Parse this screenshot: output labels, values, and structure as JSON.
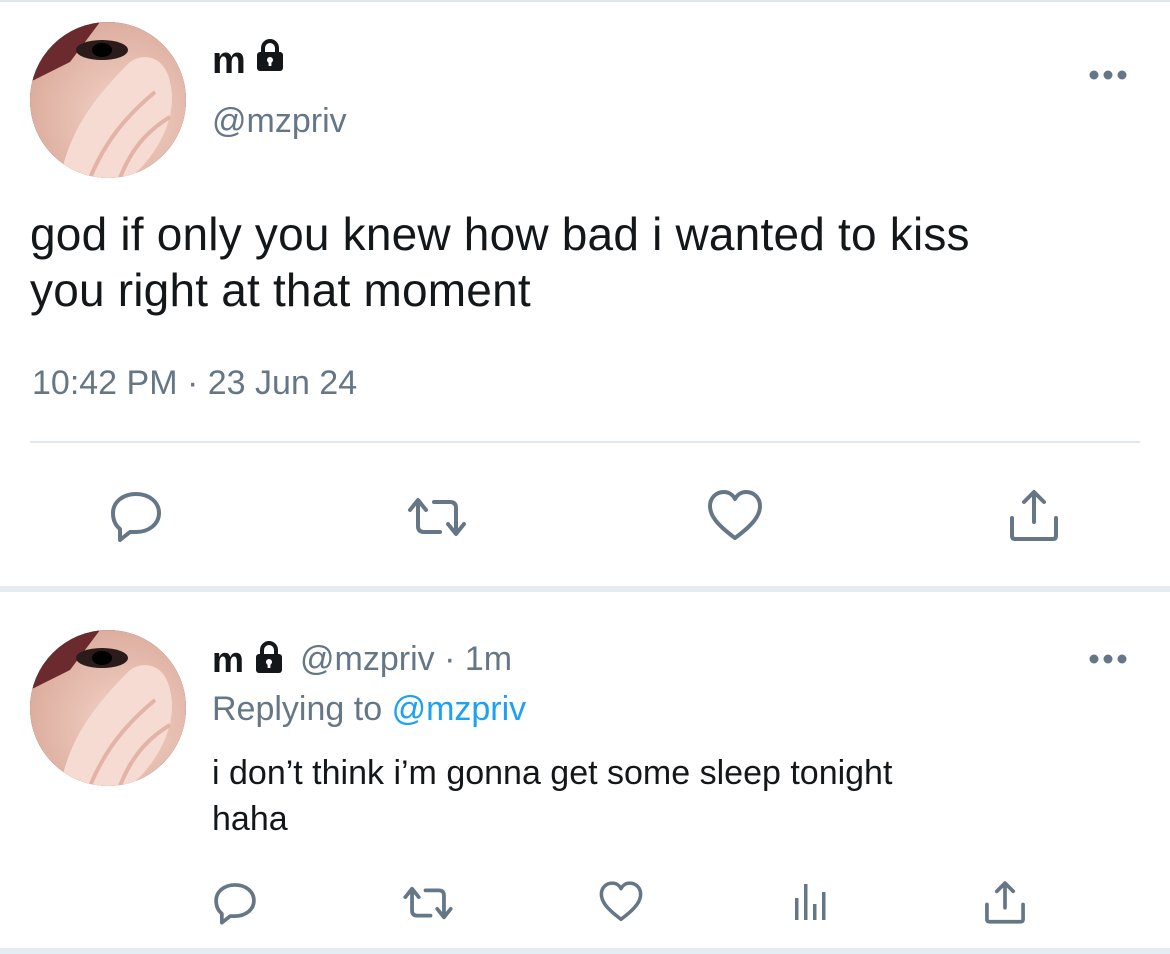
{
  "main_tweet": {
    "display_name": "m",
    "handle": "@mzpriv",
    "text_line1": "god if only you knew how bad i wanted to kiss",
    "text_line2": "you right at that moment",
    "time": "10:42 PM",
    "separator": "·",
    "date": "23 Jun 24"
  },
  "reply_tweet": {
    "display_name": "m",
    "handle": "@mzpriv",
    "separator": "·",
    "age": "1m",
    "replying_prefix": "Replying to",
    "replying_handle": "@mzpriv",
    "text_line1": "i don’t think i’m gonna get some sleep tonight",
    "text_line2": "haha"
  },
  "icons": {
    "lock": "lock-icon",
    "more": "more-icon",
    "reply": "reply-icon",
    "retweet": "retweet-icon",
    "like": "heart-icon",
    "share": "share-icon",
    "analytics": "analytics-icon"
  },
  "colors": {
    "text": "#14171a",
    "secondary": "#657786",
    "link": "#1da1f2",
    "divider": "#e1e8ed"
  }
}
